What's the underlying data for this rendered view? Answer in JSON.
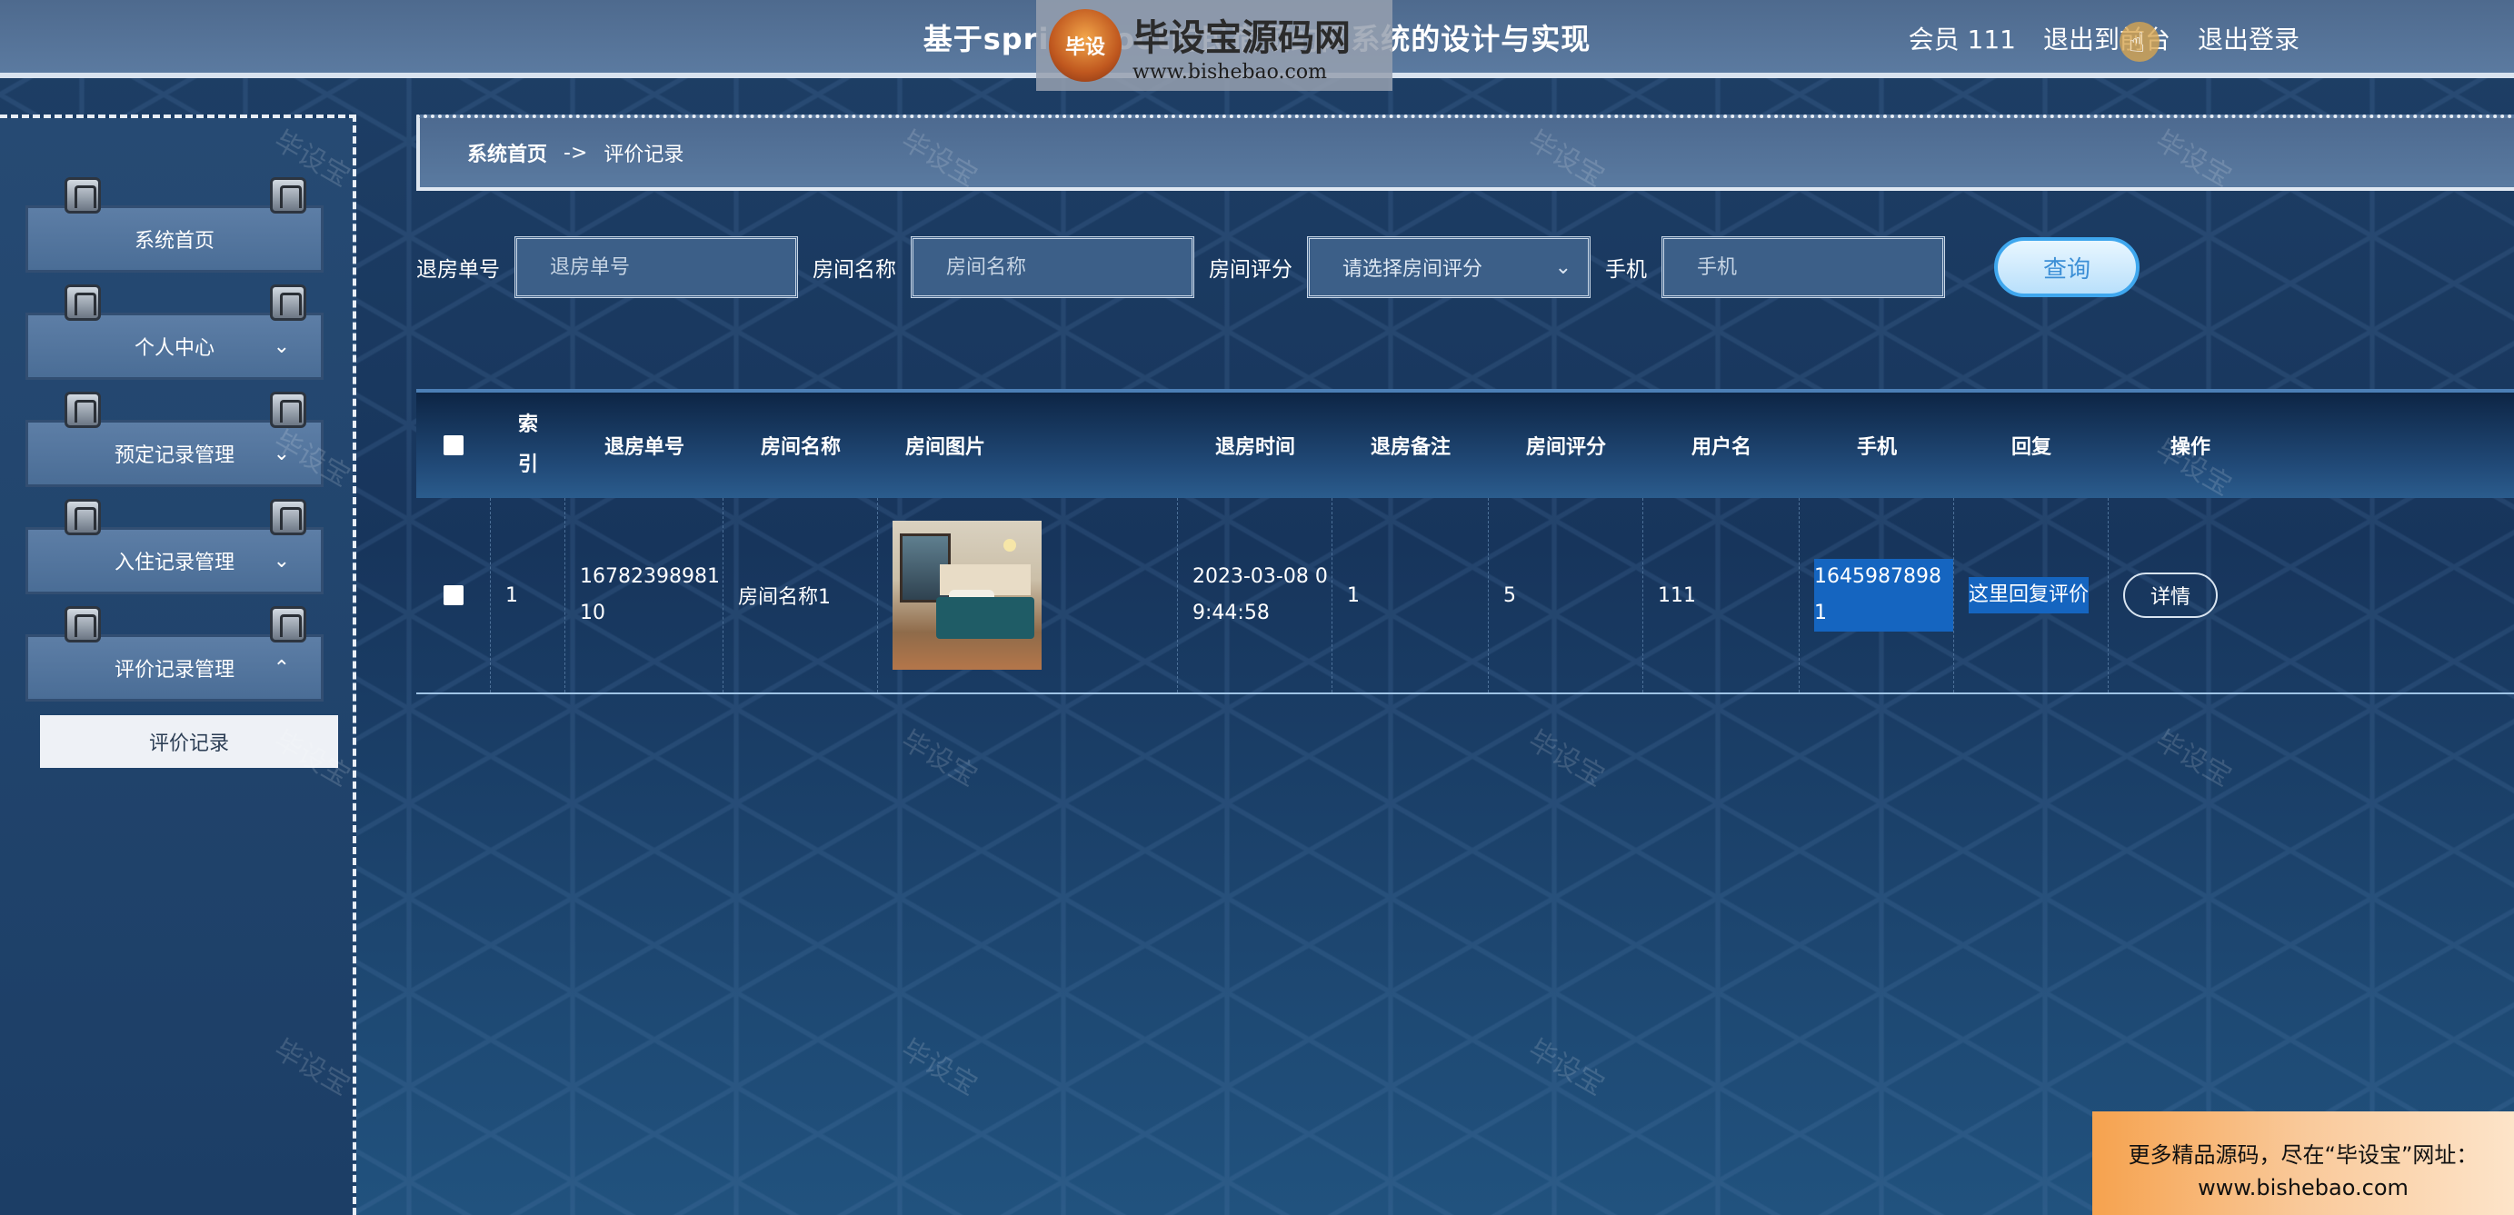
{
  "header": {
    "title": "基于springboot的民宿预约网系统的设计与实现",
    "member_label": "会员 111",
    "to_front_label": "退出到前台",
    "logout_label": "退出登录"
  },
  "brand_overlay": {
    "name": "毕设宝源码网",
    "url": "www.bishebao.com",
    "logo_text": "毕设"
  },
  "sidebar": {
    "items": [
      {
        "label": "系统首页",
        "icon": "none"
      },
      {
        "label": "个人中心",
        "icon": "chevron-down-icon"
      },
      {
        "label": "预定记录管理",
        "icon": "chevron-down-icon"
      },
      {
        "label": "入住记录管理",
        "icon": "chevron-down-icon"
      },
      {
        "label": "评价记录管理",
        "icon": "chevron-up-icon"
      }
    ],
    "sub_items": [
      {
        "label": "评价记录"
      }
    ]
  },
  "breadcrumb": {
    "home": "系统首页",
    "separator": "->",
    "current": "评价记录"
  },
  "search": {
    "checkout_no": {
      "label": "退房单号",
      "placeholder": "退房单号",
      "value": ""
    },
    "room_name": {
      "label": "房间名称",
      "placeholder": "房间名称",
      "value": ""
    },
    "room_rating": {
      "label": "房间评分",
      "placeholder": "请选择房间评分",
      "value": ""
    },
    "phone": {
      "label": "手机",
      "placeholder": "手机",
      "value": ""
    },
    "query_label": "查询"
  },
  "table": {
    "columns": [
      "索引",
      "退房单号",
      "房间名称",
      "房间图片",
      "退房时间",
      "退房备注",
      "房间评分",
      "用户名",
      "手机",
      "回复",
      "操作"
    ],
    "rows": [
      {
        "index": "1",
        "checkout_no": "1678239898110",
        "room_name": "房间名称1",
        "room_image": "hotel-room-photo",
        "checkout_time": "2023-03-08 09:44:58",
        "checkout_note": "1",
        "room_rating": "5",
        "username": "111",
        "phone": "16459878981",
        "reply": "这里回复评价",
        "action_label": "详情"
      }
    ]
  },
  "watermark_text": "毕设宝",
  "promo": {
    "line1": "更多精品源码，尽在“毕设宝”网址：",
    "line2": "www.bishebao.com"
  },
  "colors": {
    "header_bg": "#5b7aa0",
    "content_bg": "#1e3f66",
    "highlight": "#1565c0",
    "query_button_border": "#3fa7ee"
  }
}
